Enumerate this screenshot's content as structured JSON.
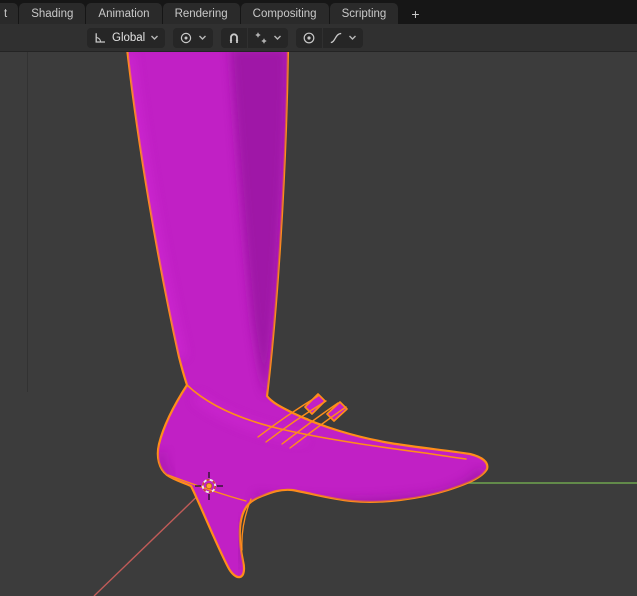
{
  "topbar": {
    "tabs": [
      {
        "label": "t"
      },
      {
        "label": "Shading"
      },
      {
        "label": "Animation"
      },
      {
        "label": "Rendering"
      },
      {
        "label": "Compositing"
      },
      {
        "label": "Scripting"
      }
    ],
    "add_workspace_label": "+"
  },
  "tool_header": {
    "orientation_label": "Global",
    "icons": [
      "transform-orientation-icon",
      "chevron-down-icon",
      "pivot-point-icon",
      "magnet-icon",
      "snap-increment-icon",
      "proportional-editing-icon",
      "falloff-curve-icon"
    ]
  },
  "viewport": {
    "scene": "selected high-heel shoe with leg, 3d cursor at object origin",
    "colors": {
      "background": "#3c3c3c",
      "object_fill": "#c120c5",
      "object_shadow": "#96129f",
      "object_highlight": "#d42cd8",
      "selection_outline": "#ff8d1a",
      "axis_y": "#6fa34e",
      "axis_x": "#c05b58",
      "cursor_red": "#c9403d",
      "cursor_white": "#ececec",
      "origin_dot": "#ffa22e"
    }
  }
}
